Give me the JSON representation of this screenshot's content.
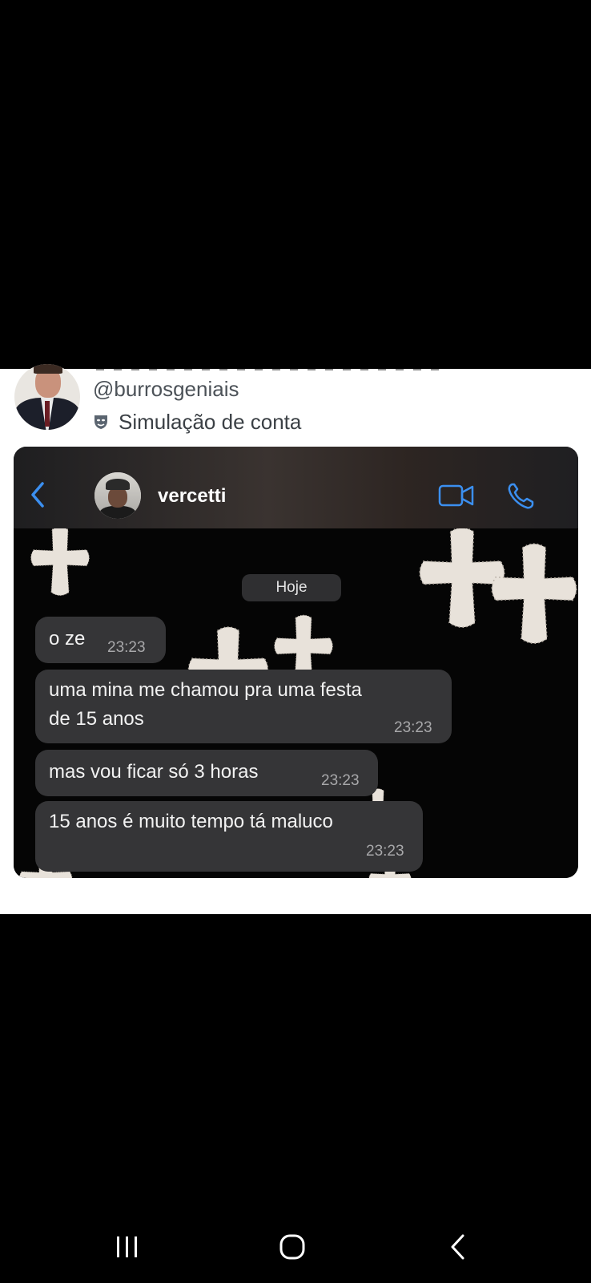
{
  "tweet": {
    "handle": "@burrosgeniais",
    "simulation_label": "Simulação de conta"
  },
  "chat": {
    "contact_name": "vercetti",
    "date_label": "Hoje",
    "messages": [
      {
        "lines": [
          "o ze"
        ],
        "time": "23:23"
      },
      {
        "lines": [
          "uma mina me chamou pra uma festa",
          "de 15 anos"
        ],
        "time": "23:23"
      },
      {
        "lines": [
          "mas vou ficar só 3 horas"
        ],
        "time": "23:23"
      },
      {
        "lines": [
          "15 anos é muito tempo tá maluco"
        ],
        "time": "23:23"
      }
    ]
  },
  "icons": {
    "back": "chevron-left-icon",
    "video": "video-camera-icon",
    "phone": "phone-icon",
    "recents": "recent-apps-icon",
    "home": "home-icon",
    "nav_back": "back-arrow-icon",
    "simulation": "theater-mask-icon"
  },
  "colors": {
    "accent": "#3b8ff0",
    "bubble": "#353537",
    "background": "#000000"
  }
}
